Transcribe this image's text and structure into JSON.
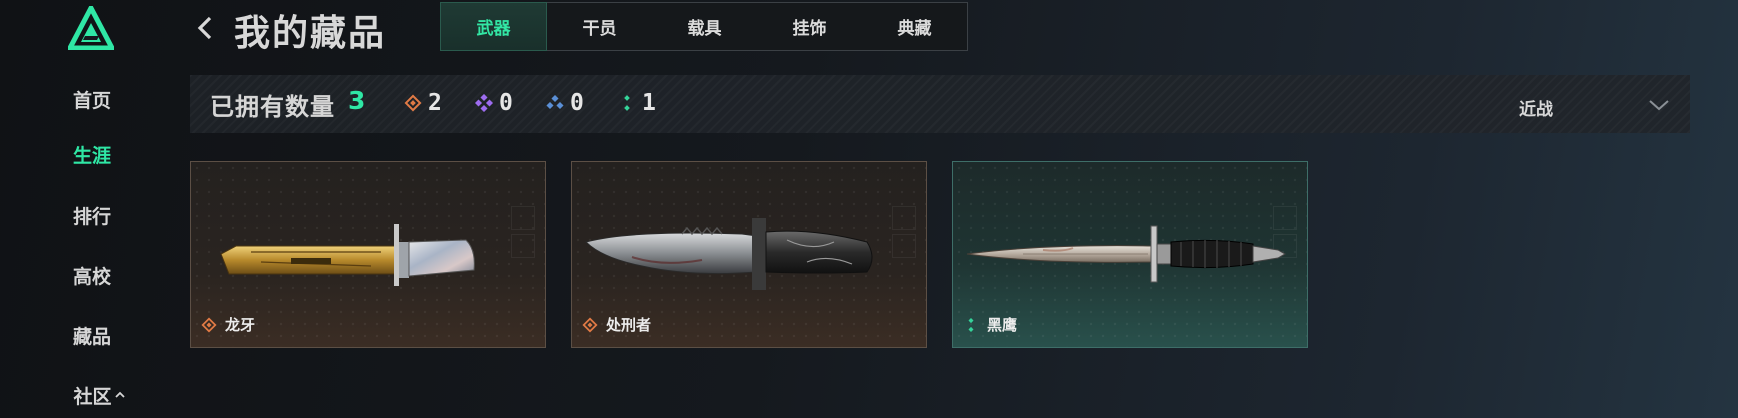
{
  "nav": {
    "items": [
      {
        "label": "首页",
        "active": false
      },
      {
        "label": "生涯",
        "active": true
      },
      {
        "label": "排行",
        "active": false
      },
      {
        "label": "高校",
        "active": false
      },
      {
        "label": "藏品",
        "active": false
      },
      {
        "label": "社区",
        "active": false,
        "expand_icon": "chevron-up-icon"
      }
    ]
  },
  "header": {
    "title": "我的藏品",
    "back_icon": "chevron-left-icon"
  },
  "tabs": [
    {
      "label": "武器",
      "active": true
    },
    {
      "label": "干员",
      "active": false
    },
    {
      "label": "载具",
      "active": false
    },
    {
      "label": "挂饰",
      "active": false
    },
    {
      "label": "典藏",
      "active": false
    }
  ],
  "stats": {
    "owned_label": "已拥有数量",
    "owned_count": "3",
    "rarities": [
      {
        "icon": "orange-diamond-icon",
        "color": "#e07a45",
        "count": "2"
      },
      {
        "icon": "purple-diamond-icon",
        "color": "#9d6cf0",
        "count": "0"
      },
      {
        "icon": "blue-diamond-icon",
        "color": "#5a8fd6",
        "count": "0"
      },
      {
        "icon": "green-diamond-icon",
        "color": "#35d49a",
        "count": "1"
      }
    ]
  },
  "filter": {
    "selected": "近战",
    "icon": "chevron-down-icon"
  },
  "items": [
    {
      "name": "龙牙",
      "rarity_icon": "orange-diamond-icon",
      "rarity_color": "#e07a45",
      "theme": "orange",
      "knife": "bayonet-gold-icon"
    },
    {
      "name": "处刑者",
      "rarity_icon": "orange-diamond-icon",
      "rarity_color": "#e07a45",
      "theme": "orange",
      "knife": "combat-knife-icon"
    },
    {
      "name": "黑鹰",
      "rarity_icon": "green-diamond-icon",
      "rarity_color": "#35d49a",
      "theme": "green",
      "knife": "dagger-icon"
    }
  ],
  "colors": {
    "accent": "#2fe7a5",
    "background": "#15191e"
  }
}
